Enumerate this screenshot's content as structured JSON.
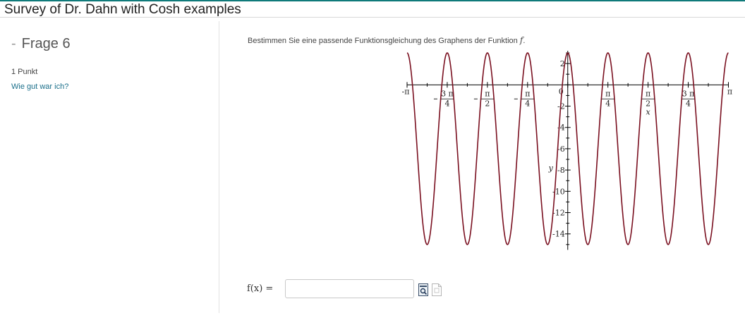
{
  "header": {
    "title": "Survey of Dr. Dahn with Cosh examples"
  },
  "question": {
    "dash": "-",
    "label": "Frage 6",
    "points": "1 Punkt",
    "rate_link": "Wie gut war ich?",
    "prompt": "Bestimmen Sie eine passende Funktionsgleichung des Graphens der Funktion",
    "prompt_var": "f",
    "prompt_end": "."
  },
  "answer": {
    "label": "f(x) =",
    "value": "",
    "placeholder": ""
  },
  "icons": {
    "preview": "preview-icon",
    "help": "help-icon"
  },
  "colors": {
    "curve": "#7a1020",
    "link": "#1a6f8a",
    "topbar": "#0f7a7a"
  },
  "chart_data": {
    "type": "line",
    "xlabel": "x",
    "ylabel": "y",
    "xlim": [
      -3.14159,
      3.14159
    ],
    "ylim": [
      -15.5,
      3.2
    ],
    "x_ticks": [
      {
        "v": -3.14159,
        "label": "-π"
      },
      {
        "v": -2.35619,
        "num": "3 π",
        "den": "4",
        "neg": true
      },
      {
        "v": -1.5708,
        "num": "π",
        "den": "2",
        "neg": true
      },
      {
        "v": -0.7854,
        "num": "π",
        "den": "4",
        "neg": true
      },
      {
        "v": 0.7854,
        "num": "π",
        "den": "4",
        "neg": false
      },
      {
        "v": 1.5708,
        "num": "π",
        "den": "2",
        "neg": false
      },
      {
        "v": 2.35619,
        "num": "3 π",
        "den": "4",
        "neg": false
      },
      {
        "v": 3.14159,
        "label": "π"
      }
    ],
    "y_ticks": [
      {
        "v": 2,
        "label": "2"
      },
      {
        "v": 0,
        "label": "0"
      },
      {
        "v": -2,
        "label": "-2"
      },
      {
        "v": -4,
        "label": "-4"
      },
      {
        "v": -6,
        "label": "-6"
      },
      {
        "v": -8,
        "label": "-8"
      },
      {
        "v": -10,
        "label": "-10"
      },
      {
        "v": -12,
        "label": "-12"
      },
      {
        "v": -14,
        "label": "-14"
      }
    ],
    "series": [
      {
        "amplitude": 9,
        "midline": -6,
        "angular_frequency": 8,
        "phase": 0
      }
    ]
  }
}
